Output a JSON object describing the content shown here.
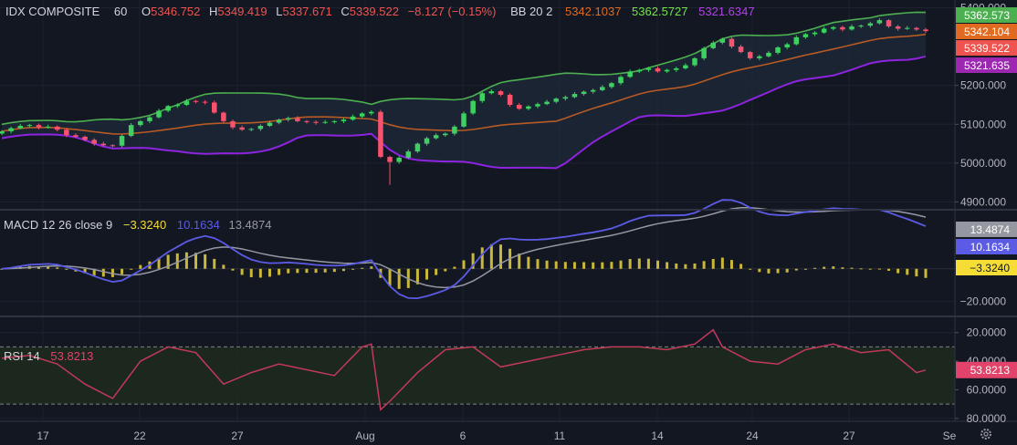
{
  "header": {
    "symbol": "IDX COMPOSITE",
    "interval": "60",
    "o_label": "O",
    "o_value": "5346.752",
    "h_label": "H",
    "h_value": "5349.419",
    "l_label": "L",
    "l_value": "5337.671",
    "c_label": "C",
    "c_value": "5339.522",
    "change": "−8.127 (−0.15%)",
    "bb_label": "BB 20 2",
    "bb_mid": "5342.1037",
    "bb_upper": "5362.5727",
    "bb_lower": "5321.6347"
  },
  "macd_legend": {
    "label": "MACD 12 26 close 9",
    "hist": "−3.3240",
    "macd": "10.1634",
    "signal": "13.4874"
  },
  "rsi_legend": {
    "label": "RSI 14",
    "value": "53.8213"
  },
  "price_axis": {
    "ticks": [
      "5400.000",
      "5200.000",
      "5100.000",
      "5000.000",
      "4900.000"
    ],
    "tags": [
      {
        "text": "5362.573",
        "color": "#4caf50"
      },
      {
        "text": "5342.104",
        "color": "#e06a1f"
      },
      {
        "text": "5339.522",
        "color": "#ef5350"
      },
      {
        "text": "5321.635",
        "color": "#9c27b0"
      }
    ]
  },
  "macd_axis": {
    "ticks": [
      "−20.0000"
    ],
    "tags": [
      {
        "text": "13.4874",
        "color": "#9598a1"
      },
      {
        "text": "10.1634",
        "color": "#5b5be6"
      },
      {
        "text": "−3.3240",
        "color": "#f5dd36"
      }
    ]
  },
  "rsi_axis": {
    "ticks": [
      "80.0000",
      "60.0000",
      "40.0000",
      "20.0000"
    ],
    "tag": {
      "text": "53.8213",
      "color": "#e2436a"
    }
  },
  "time_axis": {
    "labels": [
      "17",
      "22",
      "27",
      "Aug",
      "6",
      "11",
      "14",
      "24",
      "27",
      "Se"
    ]
  },
  "chart_data": [
    {
      "type": "candlestick",
      "title": "IDX COMPOSITE",
      "interval": "60",
      "ylim": [
        4880,
        5420
      ],
      "y_ticks": [
        4900,
        5000,
        5100,
        5200,
        5400
      ],
      "x_tick_labels": [
        "17",
        "22",
        "27",
        "Aug",
        "6",
        "11",
        "14",
        "24",
        "27",
        "Se"
      ],
      "x": [
        0,
        1,
        2,
        3,
        4,
        5,
        6,
        7,
        8,
        9,
        10,
        11,
        12,
        13,
        14,
        15,
        16,
        17,
        18,
        19,
        20,
        21,
        22,
        23,
        24,
        25,
        26,
        27,
        28,
        29,
        30,
        31,
        32,
        33,
        34,
        35,
        36,
        37,
        38,
        39,
        40,
        41,
        42,
        43,
        44,
        45,
        46,
        47,
        48,
        49,
        50,
        51,
        52,
        53,
        54,
        55,
        56,
        57,
        58,
        59,
        60,
        61,
        62,
        63,
        64,
        65,
        66,
        67,
        68,
        69,
        70,
        71,
        72,
        73,
        74,
        75,
        76,
        77,
        78,
        79,
        80,
        81,
        82,
        83,
        84,
        85,
        86,
        87,
        88,
        89,
        90,
        91,
        92,
        93,
        94,
        95,
        96,
        97,
        98,
        99,
        100
      ],
      "close": [
        5082,
        5090,
        5096,
        5098,
        5092,
        5094,
        5086,
        5072,
        5068,
        5060,
        5050,
        5046,
        5045,
        5070,
        5098,
        5108,
        5118,
        5135,
        5147,
        5150,
        5160,
        5158,
        5156,
        5130,
        5108,
        5092,
        5086,
        5088,
        5096,
        5104,
        5112,
        5116,
        5108,
        5106,
        5104,
        5106,
        5108,
        5112,
        5120,
        5128,
        5132,
        5016,
        5003,
        5014,
        5030,
        5050,
        5064,
        5072,
        5076,
        5094,
        5128,
        5160,
        5180,
        5185,
        5176,
        5150,
        5140,
        5146,
        5152,
        5158,
        5166,
        5170,
        5178,
        5184,
        5188,
        5196,
        5206,
        5222,
        5236,
        5240,
        5244,
        5236,
        5240,
        5244,
        5252,
        5270,
        5296,
        5310,
        5320,
        5300,
        5286,
        5270,
        5275,
        5284,
        5298,
        5306,
        5324,
        5332,
        5336,
        5346,
        5350,
        5344,
        5352,
        5354,
        5360,
        5368,
        5352,
        5346,
        5348,
        5344,
        5340
      ],
      "bollinger": {
        "length": 20,
        "mult": 2,
        "upper_last": 5362.5727,
        "basis_last": 5342.1037,
        "lower_last": 5321.6347
      },
      "last": {
        "open": 5346.752,
        "high": 5349.419,
        "low": 5337.671,
        "close": 5339.522,
        "change": -8.127,
        "change_pct": -0.15
      }
    },
    {
      "type": "macd",
      "fast": 12,
      "slow": 26,
      "source": "close",
      "signal_length": 9,
      "ylim": [
        -28,
        35
      ],
      "y_ticks": [
        -20
      ],
      "last": {
        "histogram": -3.324,
        "macd": 10.1634,
        "signal": 13.4874
      }
    },
    {
      "type": "rsi",
      "length": 14,
      "ylim": [
        18,
        90
      ],
      "y_ticks": [
        20,
        40,
        60,
        80
      ],
      "bands": [
        30,
        70
      ],
      "x": [
        0,
        3,
        6,
        9,
        12,
        15,
        18,
        21,
        24,
        27,
        30,
        33,
        36,
        39,
        40,
        41,
        42,
        45,
        48,
        51,
        54,
        57,
        60,
        63,
        66,
        69,
        72,
        75,
        77,
        78,
        81,
        84,
        87,
        90,
        93,
        96,
        99,
        100
      ],
      "values": [
        62,
        64,
        58,
        44,
        34,
        60,
        70,
        66,
        44,
        52,
        58,
        54,
        50,
        70,
        72,
        26,
        32,
        52,
        68,
        70,
        56,
        60,
        64,
        68,
        70,
        70,
        68,
        72,
        82,
        70,
        60,
        58,
        68,
        72,
        66,
        68,
        52,
        53.8213
      ]
    }
  ]
}
